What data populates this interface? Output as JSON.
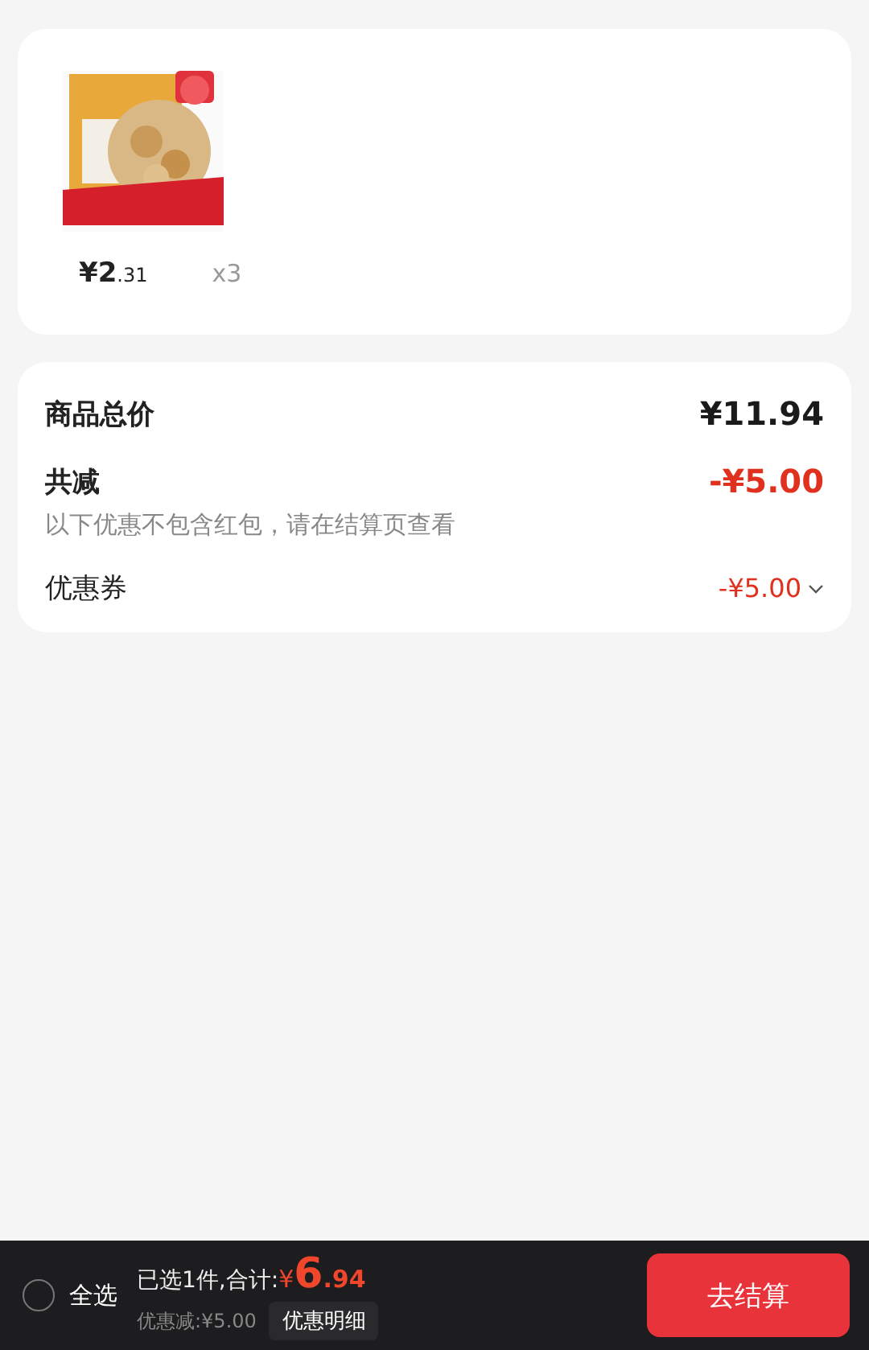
{
  "product": {
    "price_main": "¥2",
    "price_decimal": ".31",
    "quantity": "x3"
  },
  "summary": {
    "rows": [
      {
        "kind": "total",
        "label": "商品总价",
        "value": "¥11.94"
      },
      {
        "kind": "discount",
        "label": "共减",
        "value": "-¥5.00",
        "note": "以下优惠不包含红包，请在结算页查看"
      },
      {
        "kind": "coupon",
        "label": "优惠券",
        "value": "-¥5.00",
        "expanded": false
      }
    ]
  },
  "footer": {
    "select_all": {
      "label": "全选",
      "checked": false
    },
    "selected_text": "已选1件,合计:",
    "total_currency": "¥",
    "total_main": "6",
    "total_decimal": ".94",
    "discount_text": "优惠减:¥5.00",
    "detail_button": "优惠明细",
    "checkout_button": "去结算"
  }
}
